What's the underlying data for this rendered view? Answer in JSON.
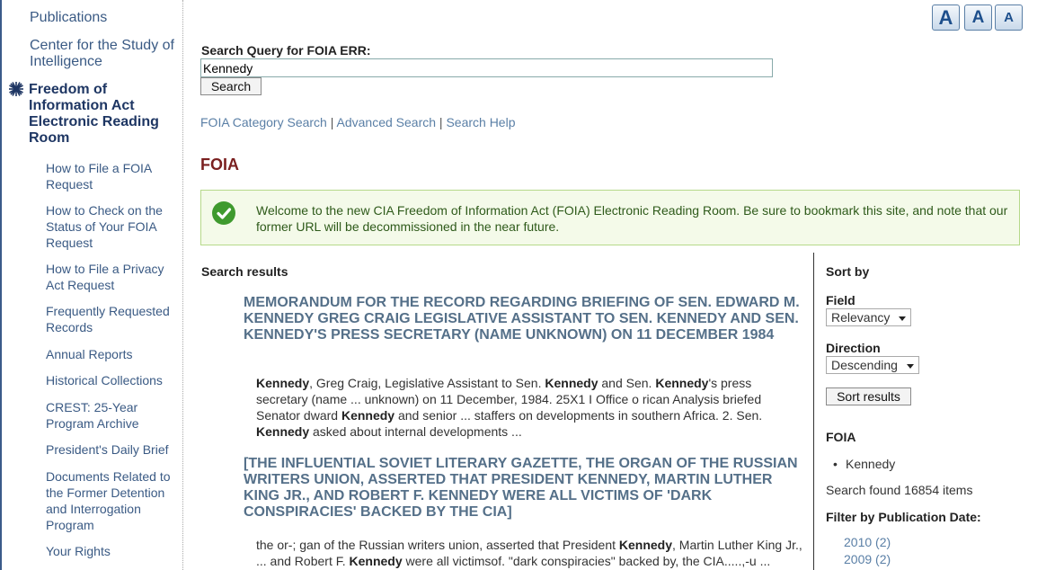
{
  "sidebar": {
    "publications": "Publications",
    "csi_line1": "Center for the Study of",
    "csi_line2": "Intelligence",
    "active_item": "Freedom of Information Act Electronic Reading Room",
    "sub_items": [
      "How to File a FOIA Request",
      "How to Check on the Status of Your FOIA Request",
      "How to File a Privacy Act Request",
      "Frequently Requested Records",
      "Annual Reports",
      "Historical Collections",
      "CREST: 25-Year Program Archive",
      "President's Daily Brief",
      "Documents Related to the Former Detention and Interrogation Program",
      "Your Rights"
    ]
  },
  "text_size": {
    "a1": "A",
    "a2": "A",
    "a3": "A"
  },
  "search": {
    "label": "Search Query for FOIA ERR:",
    "value": "Kennedy",
    "button": "Search",
    "link_category": "FOIA Category Search",
    "link_advanced": "Advanced Search",
    "link_help": "Search Help",
    "separator": "|"
  },
  "section_title": "FOIA",
  "notice": "Welcome to the new CIA Freedom of Information Act (FOIA) Electronic Reading Room.  Be sure to bookmark this site, and note that our former URL will be decommissioned in the near future.",
  "results": {
    "heading": "Search results",
    "items": [
      {
        "title": "MEMORANDUM FOR THE RECORD REGARDING BRIEFING OF SEN. EDWARD M. KENNEDY GREG CRAIG LEGISLATIVE ASSISTANT TO SEN. KENNEDY AND SEN. KENNEDY'S PRESS SECRETARY (NAME UNKNOWN) ON 11 DECEMBER 1984",
        "snippet_parts": [
          {
            "t": "Kennedy",
            "b": true
          },
          {
            "t": ", Greg Craig, Legislative Assistant to Sen. ",
            "b": false
          },
          {
            "t": "Kennedy",
            "b": true
          },
          {
            "t": " and Sen. ",
            "b": false
          },
          {
            "t": "Kennedy",
            "b": true
          },
          {
            "t": "'s press secretary (name ... unknown) on 11 December, 1984. 25X1 I Office o rican Analysis briefed Senator dward ",
            "b": false
          },
          {
            "t": "Kennedy",
            "b": true
          },
          {
            "t": " and senior ... staffers on developments in southern Africa. 2. Sen. ",
            "b": false
          },
          {
            "t": "Kennedy",
            "b": true
          },
          {
            "t": " asked about internal developments ...",
            "b": false
          }
        ]
      },
      {
        "title": "[THE INFLUENTIAL SOVIET LITERARY GAZETTE, THE ORGAN OF THE RUSSIAN WRITERS UNION, ASSERTED THAT PRESIDENT KENNEDY, MARTIN LUTHER KING JR., AND ROBERT F. KENNEDY WERE ALL VICTIMS OF 'DARK CONSPIRACIES' BACKED BY THE CIA]",
        "snippet_parts": [
          {
            "t": "the or-; gan of the Russian writers union, asserted that President ",
            "b": false
          },
          {
            "t": "Kennedy",
            "b": true
          },
          {
            "t": ", Martin Luther King Jr., ... and Robert F. ",
            "b": false
          },
          {
            "t": "Kennedy",
            "b": true
          },
          {
            "t": " were all victimsof. \"dark conspiracies\" backed by, the CIA.....,-u ...",
            "b": false
          }
        ]
      }
    ]
  },
  "sort": {
    "heading": "Sort by",
    "field_label": "Field",
    "field_value": "Relevancy",
    "direction_label": "Direction",
    "direction_value": "Descending",
    "button": "Sort results"
  },
  "facets": {
    "heading": "FOIA",
    "bullet": "Kennedy",
    "found": "Search found 16854 items",
    "date_heading": "Filter by Publication Date:",
    "years": [
      "2010 (2)",
      "2009 (2)"
    ]
  },
  "colors": {
    "accent": "#3a5a84",
    "title_red": "#7a1f1f",
    "notice_bg": "#f4fae9",
    "notice_border": "#b6d98a"
  }
}
